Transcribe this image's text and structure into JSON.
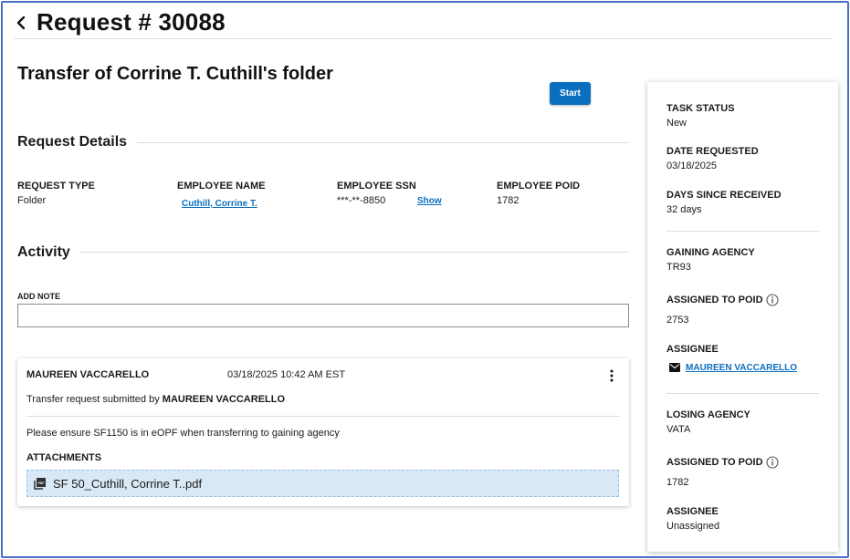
{
  "header": {
    "title": "Request # 30088"
  },
  "request": {
    "heading": "Transfer of Corrine T. Cuthill's folder",
    "start_label": "Start"
  },
  "details": {
    "section_title": "Request Details",
    "request_type_label": "REQUEST TYPE",
    "request_type_value": "Folder",
    "employee_name_label": "EMPLOYEE NAME",
    "employee_name_value": "Cuthill, Corrine T.",
    "employee_ssn_label": "EMPLOYEE SSN",
    "employee_ssn_value": "***-**-8850",
    "ssn_show_label": "Show",
    "employee_poid_label": "EMPLOYEE POID",
    "employee_poid_value": "1782"
  },
  "activity": {
    "section_title": "Activity",
    "add_note_label": "ADD NOTE",
    "add_note_value": "",
    "entry": {
      "author": "MAUREEN VACCARELLO",
      "timestamp": "03/18/2025 10:42 AM EST",
      "desc_prefix": "Transfer request submitted by ",
      "desc_author": "MAUREEN VACCARELLO",
      "note": "Please ensure SF1150 is in eOPF when transferring to gaining agency",
      "attachments_label": "ATTACHMENTS",
      "attachment_name": "SF 50_Cuthill, Corrine T..pdf"
    }
  },
  "sidebar": {
    "task_status_label": "TASK STATUS",
    "task_status_value": "New",
    "date_requested_label": "DATE REQUESTED",
    "date_requested_value": "03/18/2025",
    "days_since_label": "DAYS SINCE RECEIVED",
    "days_since_value": "32 days",
    "gaining_agency_label": "GAINING AGENCY",
    "gaining_agency_value": "TR93",
    "gaining_poid_label": "ASSIGNED TO POID",
    "gaining_poid_value": "2753",
    "gaining_assignee_label": "ASSIGNEE",
    "gaining_assignee_value": "MAUREEN VACCARELLO",
    "losing_agency_label": "LOSING AGENCY",
    "losing_agency_value": "VATA",
    "losing_poid_label": "ASSIGNED TO POID",
    "losing_poid_value": "1782",
    "losing_assignee_label": "ASSIGNEE",
    "losing_assignee_value": "Unassigned"
  },
  "colors": {
    "primary": "#0b6fbf",
    "frame_border": "#4a6fc4",
    "attachment_bg": "#d9e8f6"
  }
}
